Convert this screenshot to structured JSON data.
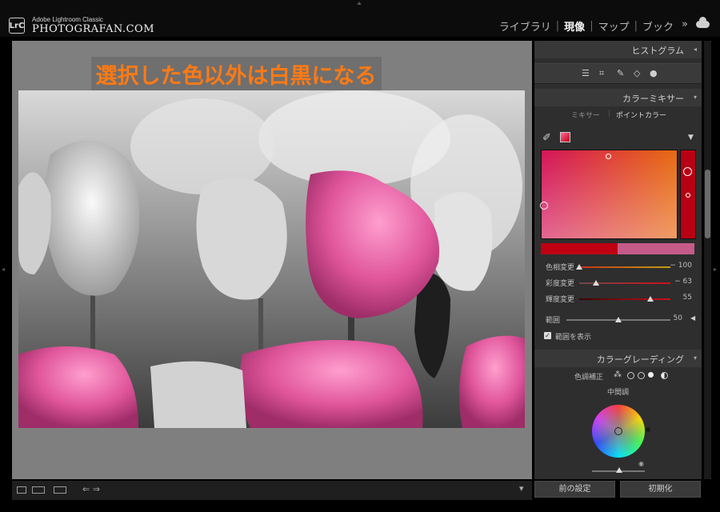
{
  "header": {
    "app_name": "Adobe Lightroom Classic",
    "brand": "PHOTOGRAFAN.COM",
    "lrc_badge": "LrC",
    "modules": [
      "ライブラリ",
      "現像",
      "マップ",
      "ブック"
    ],
    "active_module": "現像",
    "more": "»"
  },
  "main": {
    "headline": "選択した色以外は白黒になる"
  },
  "panel": {
    "histogram_title": "ヒストグラム",
    "color_mixer_title": "カラーミキサー",
    "subtab_mixer": "ミキサー",
    "subtab_point": "ポイントカラー",
    "sliders": [
      {
        "label": "色相変更",
        "value": "− 100",
        "fraction": 0.0
      },
      {
        "label": "彩度変更",
        "value": "− 63",
        "fraction": 0.18
      },
      {
        "label": "輝度変更",
        "value": "55",
        "fraction": 0.78
      }
    ],
    "range_label": "範囲",
    "range_value": "50",
    "range_fraction": 0.5,
    "show_range_label": "範囲を表示",
    "show_range_checked": true,
    "color_grading_title": "カラーグレーディング",
    "tone_adjust_label": "色調補正",
    "midtone_label": "中間調"
  },
  "footer": {
    "prev_settings": "前の設定",
    "reset": "初期化"
  },
  "colors": {
    "headline": "#ff7a14",
    "selected_color": "#c00012",
    "adjusted_color": "#c65b8a"
  },
  "icons": [
    "lrc-icon",
    "cloud-icon",
    "eyedropper-icon",
    "color-swatch-icon",
    "loupe-view-icon",
    "compare-view-icon"
  ]
}
